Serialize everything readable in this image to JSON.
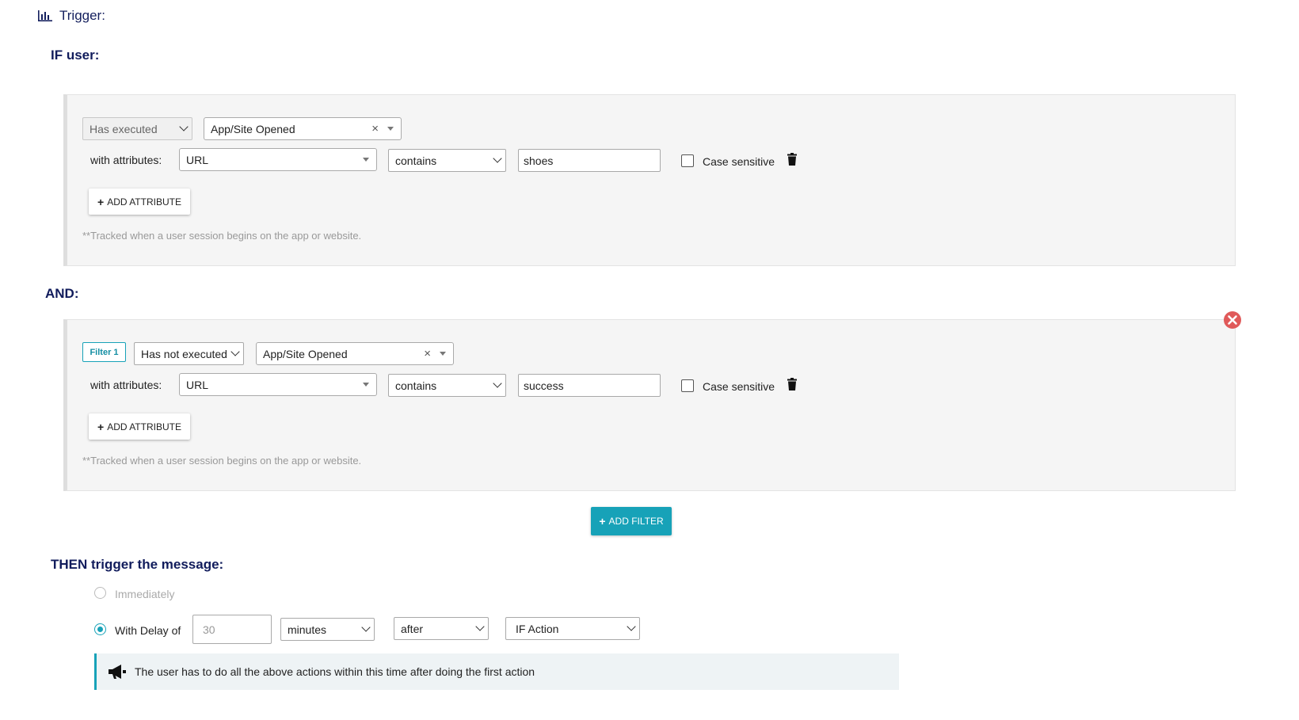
{
  "header": {
    "title": "Trigger:",
    "icon": "bar-chart-icon"
  },
  "if_section": {
    "label": "IF user:",
    "action_select": "Has executed",
    "event_select": "App/Site Opened",
    "with_attributes_label": "with attributes:",
    "attribute_select": "URL",
    "operator_select": "contains",
    "value": "shoes",
    "case_sensitive_label": "Case sensitive",
    "add_attribute_label": "ADD ATTRIBUTE",
    "note": "**Tracked when a user session begins on the app or website."
  },
  "and_section": {
    "label": "AND:",
    "filter_badge": "Filter 1",
    "action_select": "Has not executed",
    "event_select": "App/Site Opened",
    "with_attributes_label": "with attributes:",
    "attribute_select": "URL",
    "operator_select": "contains",
    "value": "success",
    "case_sensitive_label": "Case sensitive",
    "add_attribute_label": "ADD ATTRIBUTE",
    "note": "**Tracked when a user session begins on the app or website."
  },
  "add_filter_label": "ADD FILTER",
  "then_section": {
    "label": "THEN trigger the message:",
    "immediately_label": "Immediately",
    "delay_label": "With Delay of",
    "delay_placeholder": "30",
    "unit_select": "minutes",
    "relation_select": "after",
    "reference_select": "IF Action",
    "info_text": "The user has to do all the above actions within this time after doing the first action"
  },
  "colors": {
    "accent": "#17a2b8",
    "heading": "#111c5c",
    "danger": "#e05a5a"
  }
}
